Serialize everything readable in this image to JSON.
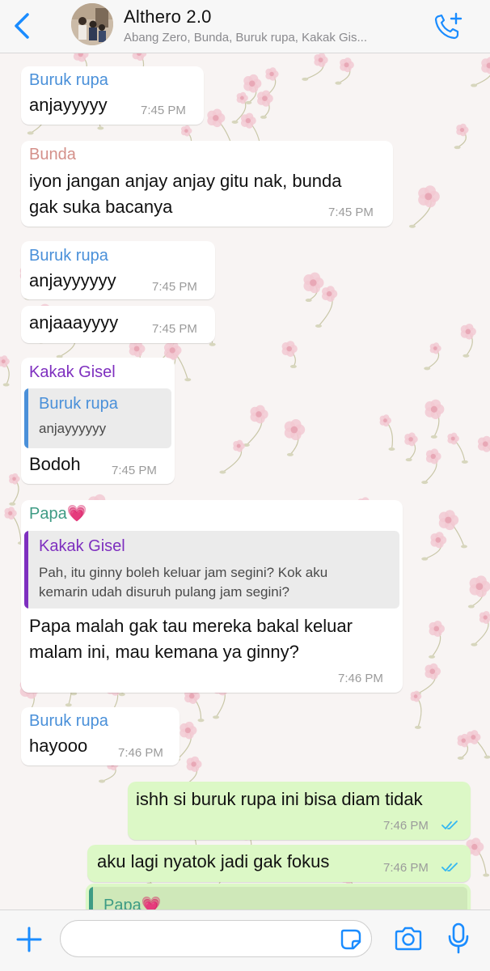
{
  "header": {
    "title": "Althero 2.0",
    "subtitle": "Abang Zero, Bunda, Buruk rupa, Kakak Gis..."
  },
  "colors": {
    "accent": "#1a8cff",
    "buruk_rupa": "#4a90d9",
    "bunda": "#d4908a",
    "kakak_gisel": "#7e2fbf",
    "papa": "#3e9b84",
    "outgoing_bubble": "#dcf8c6",
    "read_ticks": "#34b7f1"
  },
  "messages": [
    {
      "sender": "Buruk rupa",
      "text": "anjayyyyy",
      "time": "7:45 PM"
    },
    {
      "sender": "Bunda",
      "line1": "iyon jangan anjay anjay gitu nak, bunda",
      "line2": "gak suka bacanya",
      "time": "7:45 PM"
    },
    {
      "sender": "Buruk rupa",
      "text": "anjayyyyyy",
      "time": "7:45 PM"
    },
    {
      "text": "anjaaayyyy",
      "time": "7:45 PM"
    },
    {
      "sender": "Kakak Gisel",
      "quote_name": "Buruk rupa",
      "quote_text": "anjayyyyyy",
      "text": "Bodoh",
      "time": "7:45 PM"
    },
    {
      "sender": "Papa💗",
      "quote_name": "Kakak Gisel",
      "quote_line1": "Pah, itu ginny boleh keluar jam segini? Kok aku",
      "quote_line2": "kemarin udah disuruh pulang jam segini?",
      "line1": "Papa malah gak tau mereka bakal keluar",
      "line2": "malam ini, mau kemana ya ginny?",
      "time": "7:46 PM"
    },
    {
      "sender": "Buruk rupa",
      "text": "hayooo",
      "time": "7:46 PM"
    },
    {
      "text": "ishh si buruk rupa ini bisa diam tidak",
      "time": "7:46 PM",
      "outgoing": true
    },
    {
      "text": "aku lagi nyatok jadi gak fokus",
      "time": "7:46 PM",
      "outgoing": true
    },
    {
      "quote_name": "Papa💗",
      "outgoing": true
    }
  ],
  "composer": {
    "value": "",
    "placeholder": ""
  },
  "icons": {
    "back": "chevron-left-icon",
    "call": "add-call-icon",
    "plus": "plus-icon",
    "sticker": "sticker-icon",
    "camera": "camera-icon",
    "mic": "microphone-icon"
  }
}
